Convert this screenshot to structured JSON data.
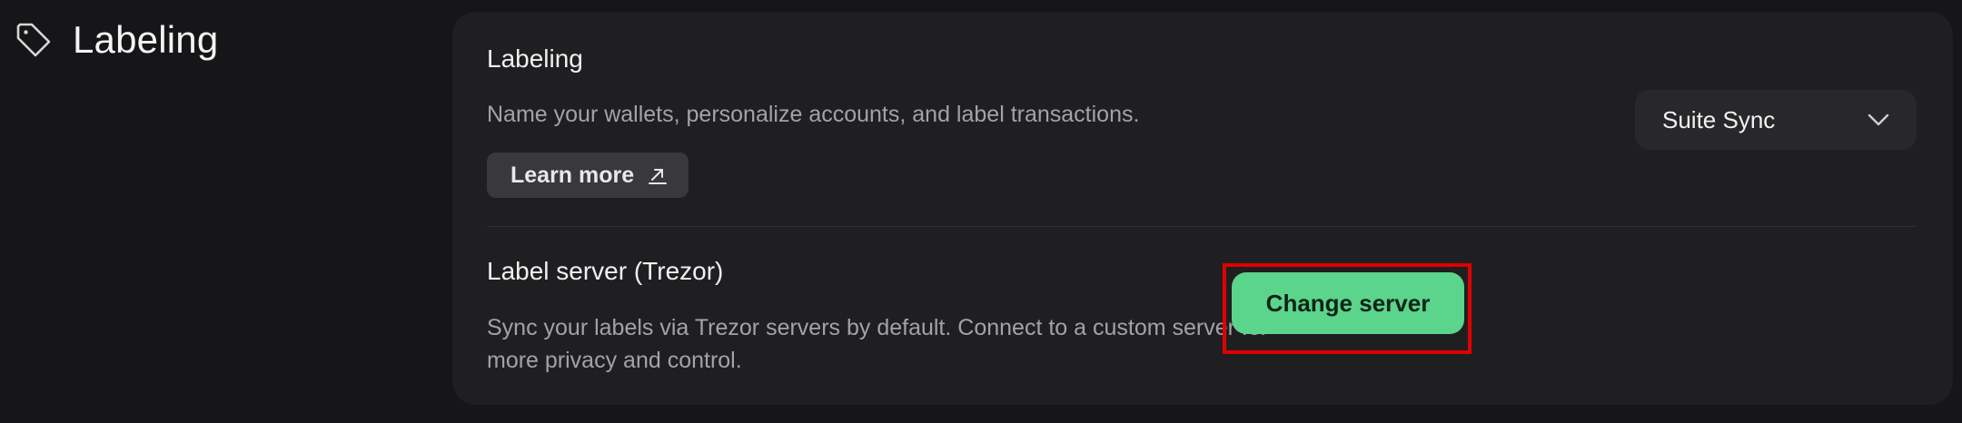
{
  "section": {
    "title": "Labeling",
    "icon": "tag-icon"
  },
  "labeling": {
    "title": "Labeling",
    "description": "Name your wallets, personalize accounts, and label transactions.",
    "learn_more_label": "Learn more",
    "learn_more_icon": "external-link-icon",
    "select": {
      "selected": "Suite Sync",
      "icon": "chevron-down-icon"
    }
  },
  "label_server": {
    "title": "Label server (Trezor)",
    "description_line1": "Sync your labels via Trezor servers by default. Connect to a custom server for",
    "description_line2": "more privacy and control.",
    "button_label": "Change server"
  },
  "colors": {
    "background": "#161618",
    "card": "#1f1f21",
    "accent_green": "#5bd48c",
    "highlight_red": "#e00000"
  }
}
